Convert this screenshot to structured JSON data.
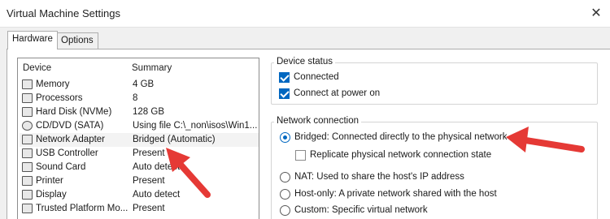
{
  "window": {
    "title": "Virtual Machine Settings",
    "close_glyph": "✕"
  },
  "tabs": [
    {
      "label": "Hardware",
      "active": true
    },
    {
      "label": "Options",
      "active": false
    }
  ],
  "device_list": {
    "columns": [
      "Device",
      "Summary"
    ],
    "rows": [
      {
        "device": "Memory",
        "summary": "4 GB",
        "icon": "memory-icon"
      },
      {
        "device": "Processors",
        "summary": "8",
        "icon": "processor-icon"
      },
      {
        "device": "Hard Disk (NVMe)",
        "summary": "128 GB",
        "icon": "hard-disk-icon"
      },
      {
        "device": "CD/DVD (SATA)",
        "summary": "Using file C:\\_non\\isos\\Win1...",
        "icon": "cd-dvd-icon"
      },
      {
        "device": "Network Adapter",
        "summary": "Bridged (Automatic)",
        "icon": "network-adapter-icon",
        "selected": true
      },
      {
        "device": "USB Controller",
        "summary": "Present",
        "icon": "usb-icon"
      },
      {
        "device": "Sound Card",
        "summary": "Auto detect",
        "icon": "sound-card-icon"
      },
      {
        "device": "Printer",
        "summary": "Present",
        "icon": "printer-icon"
      },
      {
        "device": "Display",
        "summary": "Auto detect",
        "icon": "display-icon"
      },
      {
        "device": "Trusted Platform Mo...",
        "summary": "Present",
        "icon": "tpm-icon"
      }
    ]
  },
  "device_status": {
    "title": "Device status",
    "connected_label": "Connected",
    "connected": true,
    "connect_at_power_on_label": "Connect at power on",
    "connect_at_power_on": true
  },
  "network_connection": {
    "title": "Network connection",
    "bridged_label": "Bridged: Connected directly to the physical network",
    "replicate_label": "Replicate physical network connection state",
    "replicate": false,
    "nat_label": "NAT: Used to share the host's IP address",
    "host_only_label": "Host-only: A private network shared with the host",
    "custom_label": "Custom: Specific virtual network",
    "selected": "bridged"
  },
  "colors": {
    "accent": "#0067c0",
    "annotation_arrow": "#e53935"
  }
}
